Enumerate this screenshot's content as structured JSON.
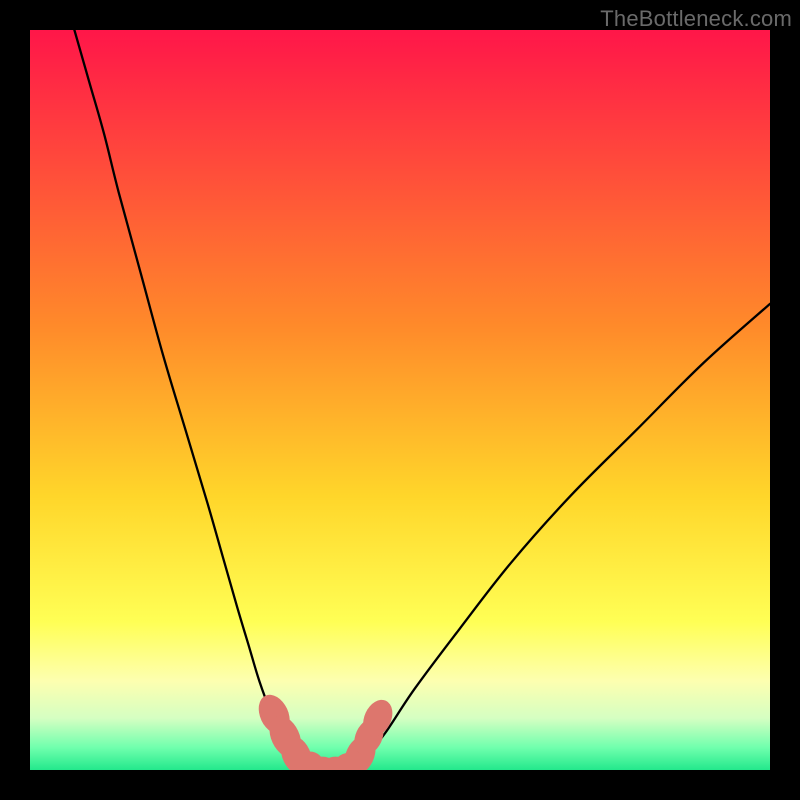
{
  "watermark": "TheBottleneck.com",
  "chart_data": {
    "type": "line",
    "title": "",
    "xlabel": "",
    "ylabel": "",
    "xlim": [
      0,
      100
    ],
    "ylim": [
      0,
      100
    ],
    "grid": false,
    "legend": false,
    "background_gradient": {
      "stops": [
        {
          "offset": 0.0,
          "color": "#ff1649"
        },
        {
          "offset": 0.4,
          "color": "#ff8a2a"
        },
        {
          "offset": 0.63,
          "color": "#ffd62a"
        },
        {
          "offset": 0.8,
          "color": "#ffff55"
        },
        {
          "offset": 0.88,
          "color": "#fdffb0"
        },
        {
          "offset": 0.93,
          "color": "#d5ffc2"
        },
        {
          "offset": 0.97,
          "color": "#6fffad"
        },
        {
          "offset": 1.0,
          "color": "#23e88c"
        }
      ]
    },
    "series": [
      {
        "name": "left-branch",
        "stroke": "#000000",
        "x": [
          6,
          8,
          10,
          12,
          15,
          18,
          21,
          24,
          26,
          28,
          29.5,
          31,
          32.5,
          34,
          35,
          36,
          37,
          38
        ],
        "y": [
          100,
          93,
          86,
          78,
          67,
          56,
          46,
          36,
          29,
          22,
          17,
          12,
          8,
          5,
          3,
          1.5,
          0.6,
          0
        ]
      },
      {
        "name": "right-branch",
        "stroke": "#000000",
        "x": [
          43,
          44,
          45.5,
          48,
          52,
          58,
          65,
          73,
          82,
          91,
          100
        ],
        "y": [
          0,
          0.6,
          2,
          5,
          11,
          19,
          28,
          37,
          46,
          55,
          63
        ]
      }
    ],
    "scatter": {
      "name": "dip-markers",
      "stroke": "#dd766d",
      "fill": "#dd766d",
      "points": [
        {
          "x": 33.0,
          "y": 7.5,
          "rx": 1.9,
          "ry": 2.8,
          "rot": -25
        },
        {
          "x": 34.5,
          "y": 4.5,
          "rx": 1.9,
          "ry": 3.0,
          "rot": -25
        },
        {
          "x": 36.0,
          "y": 2.0,
          "rx": 1.9,
          "ry": 2.8,
          "rot": -25
        },
        {
          "x": 37.8,
          "y": 0.5,
          "rx": 2.0,
          "ry": 2.0,
          "rot": 0
        },
        {
          "x": 39.5,
          "y": 0.0,
          "rx": 2.2,
          "ry": 1.8,
          "rot": 0
        },
        {
          "x": 41.3,
          "y": 0.0,
          "rx": 2.2,
          "ry": 1.8,
          "rot": 0
        },
        {
          "x": 43.0,
          "y": 0.3,
          "rx": 2.0,
          "ry": 2.0,
          "rot": 0
        },
        {
          "x": 44.6,
          "y": 2.0,
          "rx": 1.9,
          "ry": 2.8,
          "rot": 25
        },
        {
          "x": 45.8,
          "y": 4.5,
          "rx": 1.8,
          "ry": 2.6,
          "rot": 25
        },
        {
          "x": 47.0,
          "y": 7.0,
          "rx": 1.8,
          "ry": 2.6,
          "rot": 25
        }
      ]
    }
  }
}
